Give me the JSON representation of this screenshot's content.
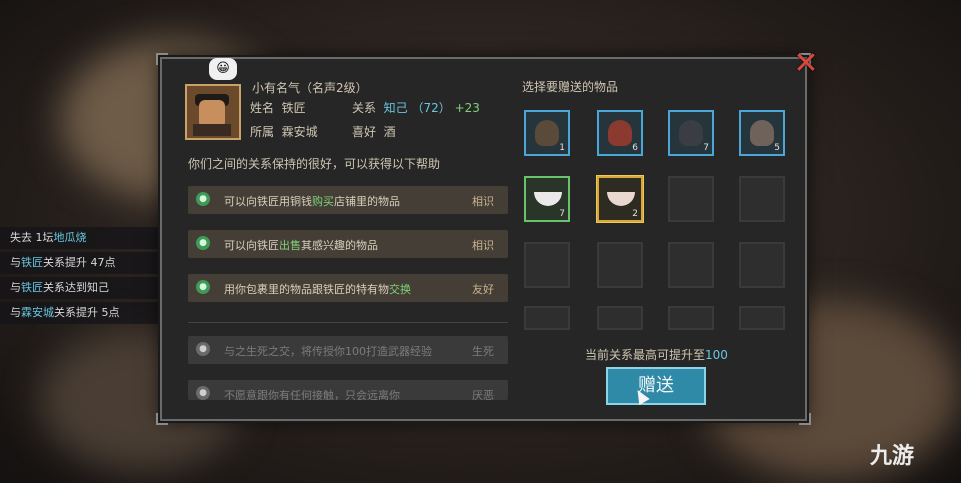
{
  "npc": {
    "title": "小有名气（名声2级）",
    "name_label": "姓名",
    "name": "铁匠",
    "relation_label": "关系",
    "relation_value": "知己",
    "relation_points": "（72）",
    "relation_bonus": "+23",
    "region_label": "所属",
    "region": "霖安城",
    "hobby_label": "喜好",
    "hobby": "酒",
    "emote": "😀"
  },
  "intro_text": "你们之间的关系保持的很好，可以获得以下帮助",
  "perks": [
    {
      "pre": "可以向铁匠用铜钱",
      "key": "购买",
      "post": "店铺里的物品",
      "level": "相识",
      "locked": false
    },
    {
      "pre": "可以向铁匠",
      "key": "出售",
      "post": "其感兴趣的物品",
      "level": "相识",
      "locked": false
    },
    {
      "pre": "用你包裹里的物品跟铁匠的特有物",
      "key": "交换",
      "post": "",
      "level": "友好",
      "locked": false
    },
    {
      "pre": "与之生死之交，将传授你100打造武器经验",
      "key": "",
      "post": "",
      "level": "生死",
      "locked": true
    },
    {
      "pre": "不愿意跟你有任何接触，只会远离你",
      "key": "",
      "post": "",
      "level": "厌恶",
      "locked": true
    }
  ],
  "gift_panel": {
    "title": "选择要赠送的物品",
    "max_text_pre": "当前关系最高可提升至",
    "max_value": "100",
    "button": "赠送"
  },
  "items": [
    {
      "icon": "dark-jar-icon",
      "count": "1",
      "color": "#5a4a3a",
      "frame": "blue"
    },
    {
      "icon": "red-jar-icon",
      "count": "6",
      "color": "#8a3a2e",
      "frame": "blue"
    },
    {
      "icon": "black-jar-icon",
      "count": "7",
      "color": "#3a3e44",
      "frame": "blue"
    },
    {
      "icon": "clay-jar-icon",
      "count": "5",
      "color": "#6e625a",
      "frame": "blue"
    },
    {
      "icon": "white-bowl-icon",
      "count": "7",
      "frame": "green"
    },
    {
      "icon": "red-bowl-icon",
      "count": "2",
      "frame": "gold"
    }
  ],
  "log": [
    {
      "pre": "失去 1坛",
      "hl": "地瓜烧",
      "post": ""
    },
    {
      "pre": "与",
      "hl": "铁匠",
      "post": "关系提升 47点"
    },
    {
      "pre": "与",
      "hl": "铁匠",
      "post": "关系达到知己"
    },
    {
      "pre": "与",
      "hl": "霖安城",
      "post": "关系提升 5点"
    }
  ],
  "watermark": "九游"
}
